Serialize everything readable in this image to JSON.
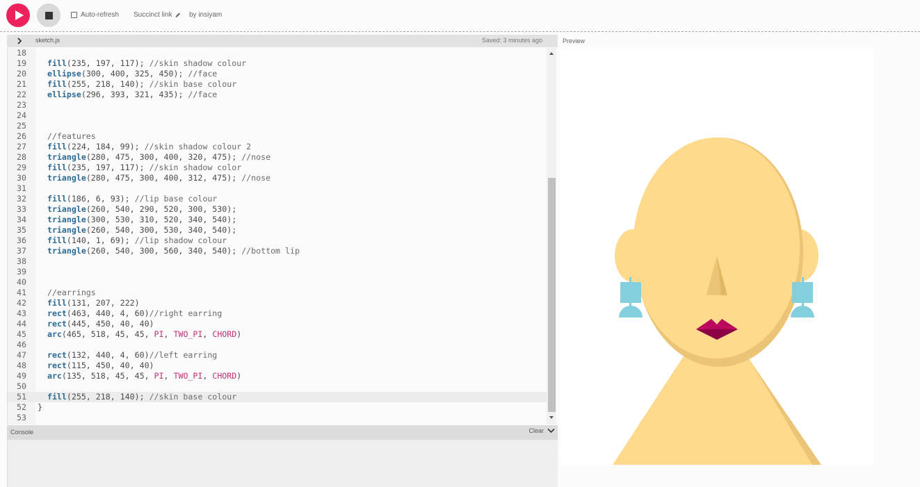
{
  "toolbar": {
    "auto_refresh_label": "Auto-refresh",
    "succinct_link_label": "Succinct link",
    "byline": "by insiyam"
  },
  "editor": {
    "file_name": "sketch.js",
    "saved_status": "Saved: 3 minutes ago",
    "active_line": 51,
    "lines": [
      {
        "n": "18",
        "t": []
      },
      {
        "n": "19",
        "t": [
          [
            "  ",
            ""
          ],
          [
            "fill",
            "kw"
          ],
          [
            "(235, 197, 117); ",
            ""
          ],
          [
            "//skin shadow colour",
            "cm"
          ]
        ]
      },
      {
        "n": "20",
        "t": [
          [
            "  ",
            ""
          ],
          [
            "ellipse",
            "kw"
          ],
          [
            "(300, 400, 325, 450); ",
            ""
          ],
          [
            "//face",
            "cm"
          ]
        ]
      },
      {
        "n": "21",
        "t": [
          [
            "  ",
            ""
          ],
          [
            "fill",
            "kw"
          ],
          [
            "(255, 218, 140); ",
            ""
          ],
          [
            "//skin base colour",
            "cm"
          ]
        ]
      },
      {
        "n": "22",
        "t": [
          [
            "  ",
            ""
          ],
          [
            "ellipse",
            "kw"
          ],
          [
            "(296, 393, 321, 435); ",
            ""
          ],
          [
            "//face",
            "cm"
          ]
        ]
      },
      {
        "n": "23",
        "t": []
      },
      {
        "n": "24",
        "t": []
      },
      {
        "n": "25",
        "t": []
      },
      {
        "n": "26",
        "t": [
          [
            "  ",
            ""
          ],
          [
            "//features",
            "cm"
          ]
        ]
      },
      {
        "n": "27",
        "t": [
          [
            "  ",
            ""
          ],
          [
            "fill",
            "kw"
          ],
          [
            "(224, 184, 99); ",
            ""
          ],
          [
            "//skin shadow colour 2",
            "cm"
          ]
        ]
      },
      {
        "n": "28",
        "t": [
          [
            "  ",
            ""
          ],
          [
            "triangle",
            "kw"
          ],
          [
            "(280, 475, 300, 400, 320, 475); ",
            ""
          ],
          [
            "//nose",
            "cm"
          ]
        ]
      },
      {
        "n": "29",
        "t": [
          [
            "  ",
            ""
          ],
          [
            "fill",
            "kw"
          ],
          [
            "(235, 197, 117); ",
            ""
          ],
          [
            "//skin shadow color",
            "cm"
          ]
        ]
      },
      {
        "n": "30",
        "t": [
          [
            "  ",
            ""
          ],
          [
            "triangle",
            "kw"
          ],
          [
            "(280, 475, 300, 400, 312, 475); ",
            ""
          ],
          [
            "//nose",
            "cm"
          ]
        ]
      },
      {
        "n": "31",
        "t": []
      },
      {
        "n": "32",
        "t": [
          [
            "  ",
            ""
          ],
          [
            "fill",
            "kw"
          ],
          [
            "(186, 6, 93); ",
            ""
          ],
          [
            "//lip base colour",
            "cm"
          ]
        ]
      },
      {
        "n": "33",
        "t": [
          [
            "  ",
            ""
          ],
          [
            "triangle",
            "kw"
          ],
          [
            "(260, 540, 290, 520, 300, 530);",
            ""
          ]
        ]
      },
      {
        "n": "34",
        "t": [
          [
            "  ",
            ""
          ],
          [
            "triangle",
            "kw"
          ],
          [
            "(300, 530, 310, 520, 340, 540);",
            ""
          ]
        ]
      },
      {
        "n": "35",
        "t": [
          [
            "  ",
            ""
          ],
          [
            "triangle",
            "kw"
          ],
          [
            "(260, 540, 300, 530, 340, 540);",
            ""
          ]
        ]
      },
      {
        "n": "36",
        "t": [
          [
            "  ",
            ""
          ],
          [
            "fill",
            "kw"
          ],
          [
            "(140, 1, 69); ",
            ""
          ],
          [
            "//lip shadow colour",
            "cm"
          ]
        ]
      },
      {
        "n": "37",
        "t": [
          [
            "  ",
            ""
          ],
          [
            "triangle",
            "kw"
          ],
          [
            "(260, 540, 300, 560, 340, 540); ",
            ""
          ],
          [
            "//bottom lip",
            "cm"
          ]
        ]
      },
      {
        "n": "38",
        "t": []
      },
      {
        "n": "39",
        "t": []
      },
      {
        "n": "40",
        "t": []
      },
      {
        "n": "41",
        "t": [
          [
            "  ",
            ""
          ],
          [
            "//earrings",
            "cm"
          ]
        ]
      },
      {
        "n": "42",
        "t": [
          [
            "  ",
            ""
          ],
          [
            "fill",
            "kw"
          ],
          [
            "(131, 207, 222)",
            ""
          ]
        ]
      },
      {
        "n": "43",
        "t": [
          [
            "  ",
            ""
          ],
          [
            "rect",
            "kw"
          ],
          [
            "(463, 440, 4, 60)",
            ""
          ],
          [
            "//right earring",
            "cm"
          ]
        ]
      },
      {
        "n": "44",
        "t": [
          [
            "  ",
            ""
          ],
          [
            "rect",
            "kw"
          ],
          [
            "(445, 450, 40, 40)",
            ""
          ]
        ]
      },
      {
        "n": "45",
        "t": [
          [
            "  ",
            ""
          ],
          [
            "arc",
            "kw"
          ],
          [
            "(465, 518, 45, 45, ",
            ""
          ],
          [
            "PI",
            "ct"
          ],
          [
            ", ",
            ""
          ],
          [
            "TWO_PI",
            "ct"
          ],
          [
            ", ",
            ""
          ],
          [
            "CHORD",
            "ct"
          ],
          [
            ")",
            ""
          ]
        ]
      },
      {
        "n": "46",
        "t": []
      },
      {
        "n": "47",
        "t": [
          [
            "  ",
            ""
          ],
          [
            "rect",
            "kw"
          ],
          [
            "(132, 440, 4, 60)",
            ""
          ],
          [
            "//left earring",
            "cm"
          ]
        ]
      },
      {
        "n": "48",
        "t": [
          [
            "  ",
            ""
          ],
          [
            "rect",
            "kw"
          ],
          [
            "(115, 450, 40, 40)",
            ""
          ]
        ]
      },
      {
        "n": "49",
        "t": [
          [
            "  ",
            ""
          ],
          [
            "arc",
            "kw"
          ],
          [
            "(135, 518, 45, 45, ",
            ""
          ],
          [
            "PI",
            "ct"
          ],
          [
            ", ",
            ""
          ],
          [
            "TWO_PI",
            "ct"
          ],
          [
            ", ",
            ""
          ],
          [
            "CHORD",
            "ct"
          ],
          [
            ")",
            ""
          ]
        ]
      },
      {
        "n": "50",
        "t": []
      },
      {
        "n": "51",
        "t": [
          [
            "  ",
            ""
          ],
          [
            "fill",
            "kw"
          ],
          [
            "(255, 218, 140); ",
            ""
          ],
          [
            "//skin base colour",
            "cm"
          ]
        ]
      },
      {
        "n": "52",
        "t": [
          [
            "}",
            ""
          ]
        ]
      },
      {
        "n": "53",
        "t": []
      }
    ]
  },
  "console": {
    "title": "Console",
    "clear_label": "Clear"
  },
  "preview": {
    "label": "Preview"
  },
  "icons": {
    "play": "play-icon",
    "stop": "stop-icon",
    "pencil": "pencil-icon",
    "chevron_right": "chevron-right-icon",
    "chevron_down": "chevron-down-icon"
  },
  "colors": {
    "play_accent": "#ed225d",
    "skin_base": "#ffda8c",
    "skin_shadow": "#ebc575",
    "skin_shadow_2": "#e0b863",
    "lip_base": "#ba065d",
    "lip_shadow": "#8c0145",
    "earring": "#83cfde"
  }
}
